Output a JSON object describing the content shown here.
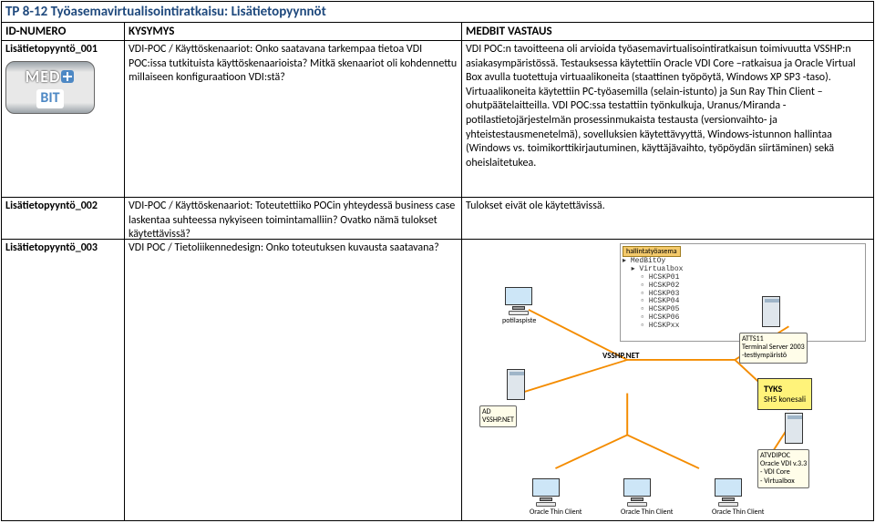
{
  "title": "TP 8-12 Työasemavirtualisointiratkaisu: Lisätietopyynnöt",
  "headers": {
    "id": "ID-NUMERO",
    "q": "KYSYMYS",
    "a": "MEDBIT VASTAUS"
  },
  "rows": [
    {
      "id": "Lisätietopyyntö_001",
      "q": "VDI-POC / Käyttöskenaariot: Onko saatavana tarkempaa tietoa VDI POC:issa tutkituista käyttöskenaarioista? Mitkä skenaariot oli kohdennettu millaiseen konfiguraatioon VDI:stä?",
      "a": "VDI POC:n tavoitteena oli arvioida työasemavirtualisointiratkaisun toimivuutta VSSHP:n asiakasympäristössä. Testauksessa käytettiin Oracle VDI Core –ratkaisua ja Oracle Virtual Box avulla tuotettuja virtuaalikoneita (staattinen työpöytä, Windows XP SP3 -taso). Virtuaalikoneita käytettiin PC-työasemilla (selain-istunto) ja Sun Ray Thin Client – ohutpäätelaitteilla. VDI POC:ssa testattiin työnkulkuja, Uranus/Miranda -potilastietojärjestelmän prosessinmukaista testausta (versionvaihto- ja yhteistestausmenetelmä), sovelluksien käytettävyyttä, Windows-istunnon hallintaa (Windows vs. toimikorttikirjautuminen, käyttäjävaihto, työpöydän siirtäminen) sekä oheislaitetukea."
    },
    {
      "id": "Lisätietopyyntö_002",
      "q": "VDI-POC / Käyttöskenaariot: Toteutettiiko POCin yhteydessä business case laskentaa suhteessa nykyiseen toimintamalliin? Ovatko nämä tulokset käytettävissä?",
      "a": "Tulokset eivät ole käytettävissä."
    },
    {
      "id": "Lisätietopyyntö_003",
      "q": "VDI POC / Tietoliikennedesign: Onko toteutuksen kuvausta saatavana?",
      "a": ""
    }
  ],
  "logo": {
    "med": "MED",
    "bit": "BIT"
  },
  "diagram": {
    "panel_title": "hallintatyöasema",
    "tree": [
      "▸ MedBitOy",
      "  ▸ Virtualbox",
      "    ▫ HCSKP01",
      "    ▫ HCSKP02",
      "    ▫ HCSKP03",
      "    ▫ HCSKP04",
      "    ▫ HCSKP05",
      "    ▫ HCSKP06",
      "    ▫ HCSKPxx"
    ],
    "labels": {
      "potilas": "potilaspiste",
      "atts11": "ATTS11\nTerminal Server 2003\n-testiympäristö",
      "ad": "AD\nVSSHP.NET",
      "tyks_title": "TYKS",
      "tyks_sub": "SH5 konesali",
      "vdipoc": "ATVDIPOC\nOracle VDI v.3.3\n- VDI Core\n- Virtualbox",
      "vsshp_net": "VSSHP.NET",
      "client1": "Oracle Thin Client",
      "client2": "Oracle Thin Client",
      "client3": "Oracle Thin Client"
    }
  }
}
